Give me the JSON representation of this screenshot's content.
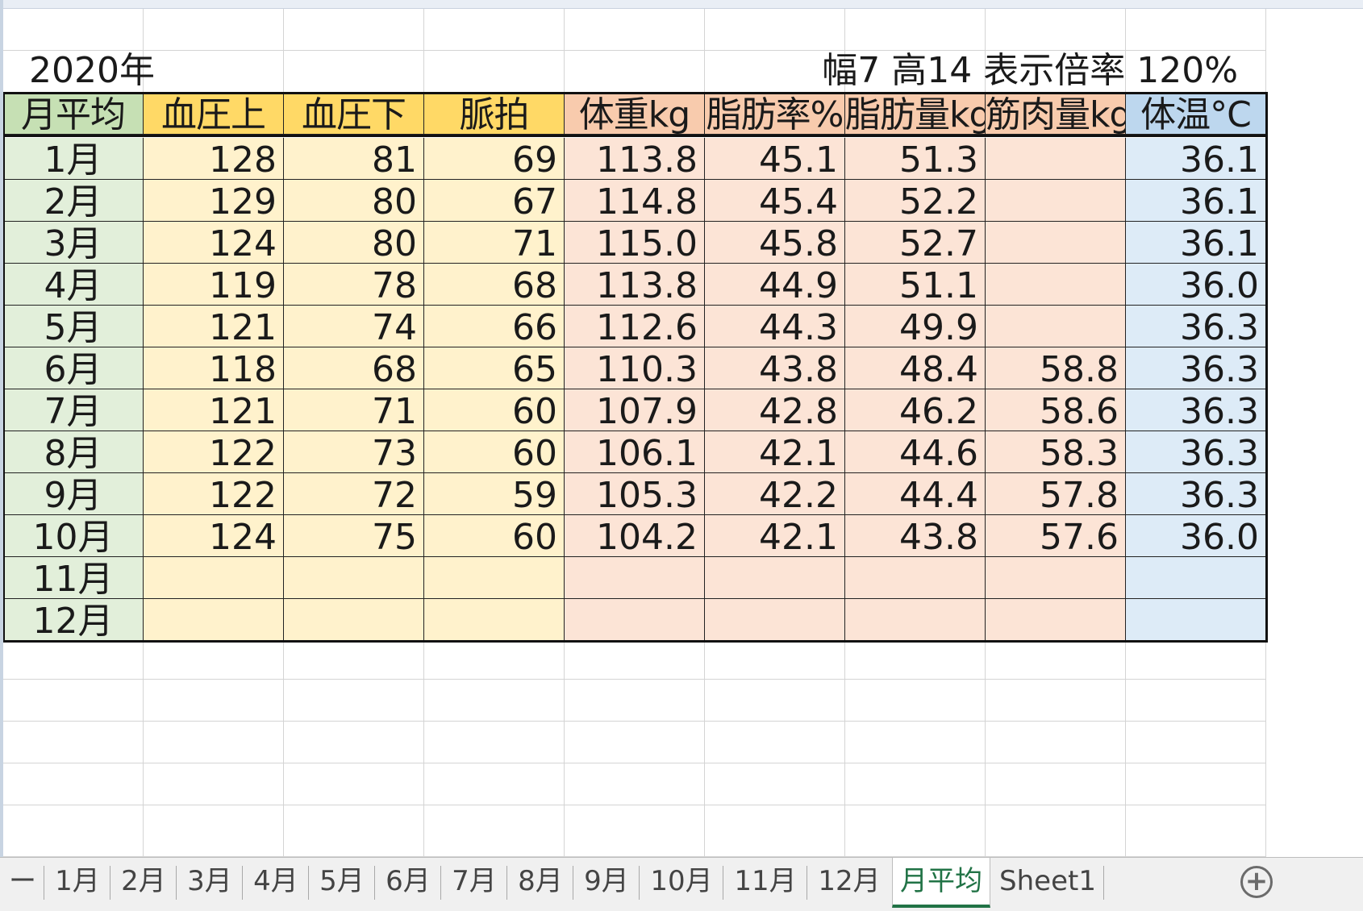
{
  "sheet": {
    "year_label": "2020年",
    "info_label": "幅7 高14 表示倍率 120%",
    "headers": [
      "月平均",
      "血圧上",
      "血圧下",
      "脈拍",
      "体重kg",
      "脂肪率%",
      "脂肪量kg",
      "筋肉量kg",
      "体温°C"
    ],
    "rows": [
      [
        "1月",
        "128",
        "81",
        "69",
        "113.8",
        "45.1",
        "51.3",
        "",
        "36.1"
      ],
      [
        "2月",
        "129",
        "80",
        "67",
        "114.8",
        "45.4",
        "52.2",
        "",
        "36.1"
      ],
      [
        "3月",
        "124",
        "80",
        "71",
        "115.0",
        "45.8",
        "52.7",
        "",
        "36.1"
      ],
      [
        "4月",
        "119",
        "78",
        "68",
        "113.8",
        "44.9",
        "51.1",
        "",
        "36.0"
      ],
      [
        "5月",
        "121",
        "74",
        "66",
        "112.6",
        "44.3",
        "49.9",
        "",
        "36.3"
      ],
      [
        "6月",
        "118",
        "68",
        "65",
        "110.3",
        "43.8",
        "48.4",
        "58.8",
        "36.3"
      ],
      [
        "7月",
        "121",
        "71",
        "60",
        "107.9",
        "42.8",
        "46.2",
        "58.6",
        "36.3"
      ],
      [
        "8月",
        "122",
        "73",
        "60",
        "106.1",
        "42.1",
        "44.6",
        "58.3",
        "36.3"
      ],
      [
        "9月",
        "122",
        "72",
        "59",
        "105.3",
        "42.2",
        "44.4",
        "57.8",
        "36.3"
      ],
      [
        "10月",
        "124",
        "75",
        "60",
        "104.2",
        "42.1",
        "43.8",
        "57.6",
        "36.0"
      ],
      [
        "11月",
        "",
        "",
        "",
        "",
        "",
        "",
        "",
        ""
      ],
      [
        "12月",
        "",
        "",
        "",
        "",
        "",
        "",
        "",
        ""
      ]
    ]
  },
  "colors": {
    "month_header": "#c6e0b4",
    "month_cell": "#e2efda",
    "bp_header": "#ffd966",
    "bp_cell": "#fff2cc",
    "body_header": "#f8cbad",
    "body_cell": "#fce4d6",
    "temp_header": "#bdd7ee",
    "temp_cell": "#ddebf7",
    "active_tab": "#217346"
  },
  "tabs": [
    {
      "label": "ー",
      "active": false
    },
    {
      "label": "1月",
      "active": false
    },
    {
      "label": "2月",
      "active": false
    },
    {
      "label": "3月",
      "active": false
    },
    {
      "label": "4月",
      "active": false
    },
    {
      "label": "5月",
      "active": false
    },
    {
      "label": "6月",
      "active": false
    },
    {
      "label": "7月",
      "active": false
    },
    {
      "label": "8月",
      "active": false
    },
    {
      "label": "9月",
      "active": false
    },
    {
      "label": "10月",
      "active": false
    },
    {
      "label": "11月",
      "active": false
    },
    {
      "label": "12月",
      "active": false
    },
    {
      "label": "月平均",
      "active": true
    },
    {
      "label": "Sheet1",
      "active": false
    }
  ],
  "add_sheet_icon": "plus-circle-icon"
}
